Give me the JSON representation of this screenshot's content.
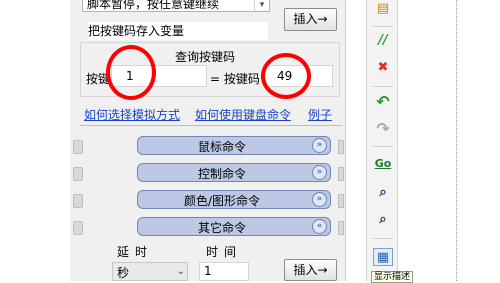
{
  "top": {
    "pause_text": "脚本暂停，按任意键继续",
    "save_key_label": "把按键码存入变量",
    "insert_label": "插入→"
  },
  "query": {
    "title": "查询按键码",
    "key_label": "按键",
    "key_value": "1",
    "equals_label": "= 按键码",
    "code_value": "49"
  },
  "links": {
    "simulate_mode": "如何选择模拟方式",
    "keyboard_cmd": "如何使用键盘命令",
    "example": "例子"
  },
  "categories": [
    {
      "label": "鼠标命令",
      "chevron": "»",
      "expanded": false
    },
    {
      "label": "控制命令",
      "chevron": "»",
      "expanded": false
    },
    {
      "label": "颜色/图形命令",
      "chevron": "»",
      "expanded": false
    },
    {
      "label": "其它命令",
      "chevron": "«",
      "expanded": true
    }
  ],
  "delay": {
    "title": "延时",
    "time_label": "时间",
    "unit_value": "秒",
    "time_value": "1",
    "insert_label": "插入→"
  },
  "toolbar": {
    "green_bar": "//",
    "red_x": "✖",
    "undo": "↶",
    "redo": "↷",
    "go": "Go",
    "bottom_text": "显示描述"
  },
  "colors": {
    "annotation_red": "#ff0000",
    "link_blue": "#1a44c4",
    "category_fill": "#bcc8e4"
  }
}
